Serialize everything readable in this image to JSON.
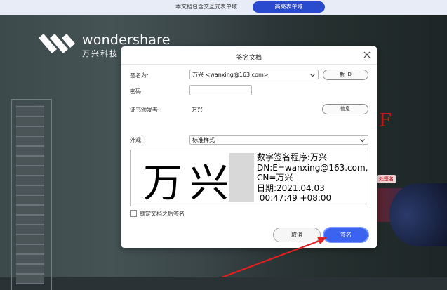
{
  "topbar": {
    "notice": "本文档包含交互式表单域",
    "highlight_button": "高亮表单域"
  },
  "background": {
    "logo_en": "wondershare",
    "logo_zh": "万兴科技",
    "signature_tag": "处签名"
  },
  "dialog": {
    "title": "签名文档",
    "sign_as_label": "签名为:",
    "sign_as_value": "万兴 <wanxing@163.com>",
    "new_id_button": "新 ID",
    "password_label": "密码:",
    "password_value": "",
    "issuer_label": "证书颁发者:",
    "issuer_value": "万兴",
    "info_button": "信息",
    "appearance_label": "外观:",
    "appearance_value": "标准样式",
    "preview": {
      "name": "万兴",
      "line1": "数字签名程序:万兴",
      "line2": "DN:E=wanxing@163.com,",
      "line3": "CN=万兴",
      "line4": "日期:2021.04.03",
      "line5": " 00:47:49 +08:00"
    },
    "lock_label": "锁定文档之后签名",
    "lock_checked": false,
    "cancel_button": "取消",
    "sign_button": "签名"
  },
  "colors": {
    "accent": "#3b63f0",
    "topbar_button": "#2b4bcf",
    "arrow": "#e02020"
  }
}
